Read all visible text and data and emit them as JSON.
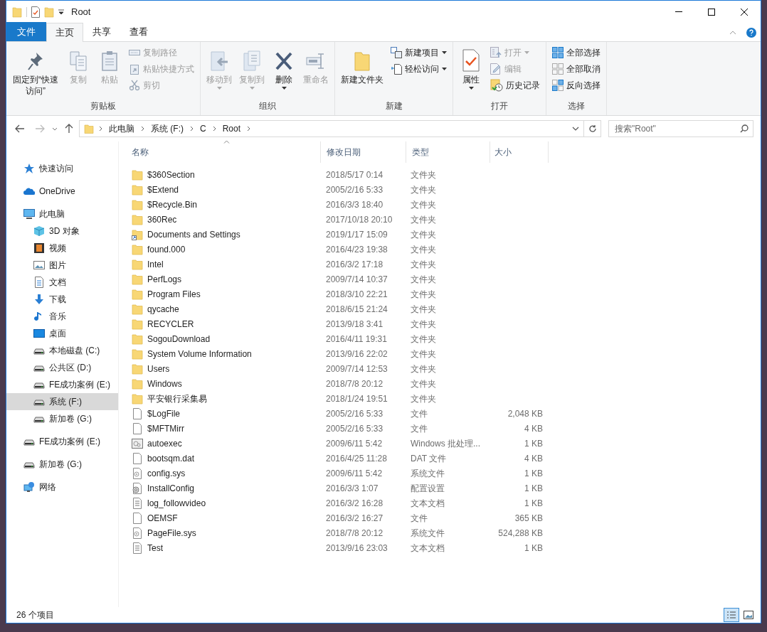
{
  "window": {
    "title": "Root"
  },
  "ribbon_tabs": [
    {
      "label": "文件",
      "kind": "file",
      "selected": false
    },
    {
      "label": "主页",
      "kind": "tab",
      "selected": true
    },
    {
      "label": "共享",
      "kind": "tab",
      "selected": false
    },
    {
      "label": "查看",
      "kind": "tab",
      "selected": false
    }
  ],
  "ribbon_groups": [
    {
      "label": "剪贴板",
      "items": [
        {
          "label": "固定到“快速访问”",
          "kind": "large",
          "disabled": false,
          "dropdown": false
        },
        {
          "label": "复制",
          "kind": "large",
          "disabled": true,
          "dropdown": false
        },
        {
          "label": "粘贴",
          "kind": "large",
          "disabled": true,
          "dropdown": false
        },
        {
          "label": "复制路径",
          "kind": "small",
          "disabled": true,
          "dropdown": false
        },
        {
          "label": "粘贴快捷方式",
          "kind": "small",
          "disabled": true,
          "dropdown": false
        },
        {
          "label": "剪切",
          "kind": "small",
          "disabled": true,
          "dropdown": false
        }
      ]
    },
    {
      "label": "组织",
      "items": [
        {
          "label": "移动到",
          "kind": "large",
          "disabled": true,
          "dropdown": true
        },
        {
          "label": "复制到",
          "kind": "large",
          "disabled": true,
          "dropdown": true
        },
        {
          "label": "删除",
          "kind": "large",
          "disabled": false,
          "dropdown": true
        },
        {
          "label": "重命名",
          "kind": "large",
          "disabled": true,
          "dropdown": false
        }
      ]
    },
    {
      "label": "新建",
      "items": [
        {
          "label": "新建文件夹",
          "kind": "large",
          "disabled": false,
          "dropdown": false
        },
        {
          "label": "新建项目",
          "kind": "small",
          "disabled": false,
          "dropdown": true
        },
        {
          "label": "轻松访问",
          "kind": "small",
          "disabled": false,
          "dropdown": true
        }
      ]
    },
    {
      "label": "打开",
      "items": [
        {
          "label": "属性",
          "kind": "large",
          "disabled": false,
          "dropdown": true
        },
        {
          "label": "打开",
          "kind": "small",
          "disabled": true,
          "dropdown": true
        },
        {
          "label": "编辑",
          "kind": "small",
          "disabled": true,
          "dropdown": false
        },
        {
          "label": "历史记录",
          "kind": "small",
          "disabled": false,
          "dropdown": false
        }
      ]
    },
    {
      "label": "选择",
      "items": [
        {
          "label": "全部选择",
          "kind": "small",
          "disabled": false,
          "dropdown": false
        },
        {
          "label": "全部取消",
          "kind": "small",
          "disabled": false,
          "dropdown": false
        },
        {
          "label": "反向选择",
          "kind": "small",
          "disabled": false,
          "dropdown": false
        }
      ]
    }
  ],
  "address": {
    "path": [
      "此电脑",
      "系统 (F:)",
      "C",
      "Root"
    ],
    "search_placeholder": "搜索\"Root\""
  },
  "sidebar": {
    "items": [
      {
        "label": "快速访问",
        "selected": false
      },
      {
        "label": "OneDrive",
        "selected": false
      },
      {
        "label": "此电脑",
        "selected": false,
        "children": [
          {
            "label": "3D 对象",
            "selected": false
          },
          {
            "label": "视频",
            "selected": false
          },
          {
            "label": "图片",
            "selected": false
          },
          {
            "label": "文档",
            "selected": false
          },
          {
            "label": "下载",
            "selected": false
          },
          {
            "label": "音乐",
            "selected": false
          },
          {
            "label": "桌面",
            "selected": false
          },
          {
            "label": "本地磁盘 (C:)",
            "selected": false
          },
          {
            "label": "公共区 (D:)",
            "selected": false
          },
          {
            "label": "FE成功案例 (E:)",
            "selected": false
          },
          {
            "label": "系统 (F:)",
            "selected": true
          },
          {
            "label": "新加卷 (G:)",
            "selected": false
          }
        ]
      },
      {
        "label": "FE成功案例 (E:)",
        "selected": false
      },
      {
        "label": "新加卷 (G:)",
        "selected": false
      },
      {
        "label": "网络",
        "selected": false
      }
    ]
  },
  "table": {
    "columns": [
      {
        "label": "名称",
        "sorted": true
      },
      {
        "label": "修改日期",
        "sorted": false
      },
      {
        "label": "类型",
        "sorted": false
      },
      {
        "label": "大小",
        "sorted": false
      }
    ],
    "rows": [
      {
        "kind": "folder",
        "name": "$360Section",
        "date": "2018/5/17 0:14",
        "type": "文件夹",
        "size": ""
      },
      {
        "kind": "folder",
        "name": "$Extend",
        "date": "2005/2/16 5:33",
        "type": "文件夹",
        "size": ""
      },
      {
        "kind": "folder",
        "name": "$Recycle.Bin",
        "date": "2016/3/3 18:40",
        "type": "文件夹",
        "size": ""
      },
      {
        "kind": "folder",
        "name": "360Rec",
        "date": "2017/10/18 20:10",
        "type": "文件夹",
        "size": ""
      },
      {
        "kind": "shortcut",
        "name": "Documents and Settings",
        "date": "2019/1/17 15:09",
        "type": "文件夹",
        "size": ""
      },
      {
        "kind": "folder",
        "name": "found.000",
        "date": "2016/4/23 19:38",
        "type": "文件夹",
        "size": ""
      },
      {
        "kind": "folder",
        "name": "Intel",
        "date": "2016/3/2 17:18",
        "type": "文件夹",
        "size": ""
      },
      {
        "kind": "folder",
        "name": "PerfLogs",
        "date": "2009/7/14 10:37",
        "type": "文件夹",
        "size": ""
      },
      {
        "kind": "folder",
        "name": "Program Files",
        "date": "2018/3/10 22:21",
        "type": "文件夹",
        "size": ""
      },
      {
        "kind": "folder",
        "name": "qycache",
        "date": "2018/6/15 21:24",
        "type": "文件夹",
        "size": ""
      },
      {
        "kind": "folder",
        "name": "RECYCLER",
        "date": "2013/9/18 3:41",
        "type": "文件夹",
        "size": ""
      },
      {
        "kind": "folder",
        "name": "SogouDownload",
        "date": "2016/4/11 19:31",
        "type": "文件夹",
        "size": ""
      },
      {
        "kind": "folder",
        "name": "System Volume Information",
        "date": "2013/9/16 22:02",
        "type": "文件夹",
        "size": ""
      },
      {
        "kind": "folder",
        "name": "Users",
        "date": "2009/7/14 12:53",
        "type": "文件夹",
        "size": ""
      },
      {
        "kind": "folder",
        "name": "Windows",
        "date": "2018/7/8 20:12",
        "type": "文件夹",
        "size": ""
      },
      {
        "kind": "folder",
        "name": "平安银行采集易",
        "date": "2018/1/24 19:51",
        "type": "文件夹",
        "size": ""
      },
      {
        "kind": "file",
        "name": "$LogFile",
        "date": "2005/2/16 5:33",
        "type": "文件",
        "size": "2,048 KB"
      },
      {
        "kind": "file",
        "name": "$MFTMirr",
        "date": "2005/2/16 5:33",
        "type": "文件",
        "size": "4 KB"
      },
      {
        "kind": "batch",
        "name": "autoexec",
        "date": "2009/6/11 5:42",
        "type": "Windows 批处理...",
        "size": "1 KB"
      },
      {
        "kind": "file",
        "name": "bootsqm.dat",
        "date": "2016/4/25 11:28",
        "type": "DAT 文件",
        "size": "4 KB"
      },
      {
        "kind": "system",
        "name": "config.sys",
        "date": "2009/6/11 5:42",
        "type": "系统文件",
        "size": "1 KB"
      },
      {
        "kind": "settings",
        "name": "InstallConfig",
        "date": "2016/3/3 1:07",
        "type": "配置设置",
        "size": "1 KB"
      },
      {
        "kind": "text",
        "name": "log_followvideo",
        "date": "2016/3/2 16:28",
        "type": "文本文档",
        "size": "1 KB"
      },
      {
        "kind": "file",
        "name": "OEMSF",
        "date": "2016/3/2 16:27",
        "type": "文件",
        "size": "365 KB"
      },
      {
        "kind": "system",
        "name": "PageFile.sys",
        "date": "2018/7/8 20:12",
        "type": "系统文件",
        "size": "524,288 KB"
      },
      {
        "kind": "text",
        "name": "Test",
        "date": "2013/9/16 23:03",
        "type": "文本文档",
        "size": "1 KB"
      }
    ]
  },
  "status_bar": {
    "item_count": "26 个项目",
    "views": [
      {
        "selected": true
      },
      {
        "selected": false
      }
    ]
  }
}
